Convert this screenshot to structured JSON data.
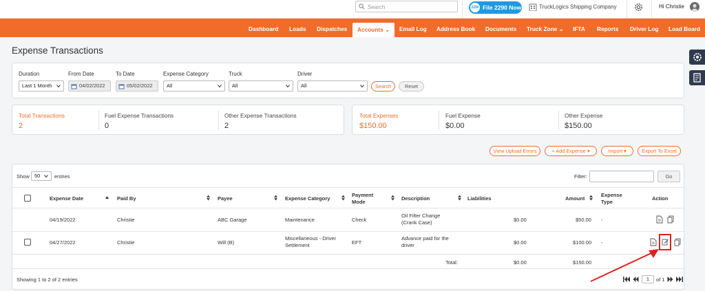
{
  "topbar": {
    "search_placeholder": "Search",
    "file2290_label": "File 2290 Now",
    "file2290_badge": "2290",
    "company_name": "TruckLogics Shipping Company",
    "greeting": "Hi Christie"
  },
  "nav": {
    "items": [
      "Dashboard",
      "Loads",
      "Dispatches",
      "Accounts",
      "Email Log",
      "Address Book",
      "Documents",
      "Truck Zone",
      "IFTA",
      "Reports",
      "Driver Log",
      "Load Board"
    ],
    "active": "Accounts"
  },
  "page": {
    "title": "Expense Transactions"
  },
  "filters": {
    "duration_label": "Duration",
    "duration_value": "Last 1 Month",
    "from_label": "From Date",
    "from_value": "04/02/2022",
    "to_label": "To Date",
    "to_value": "05/02/2022",
    "category_label": "Expense Category",
    "category_value": "All",
    "truck_label": "Truck",
    "truck_value": "All",
    "driver_label": "Driver",
    "driver_value": "All",
    "search_btn": "Search",
    "reset_btn": "Reset"
  },
  "summary": {
    "total_transactions_label": "Total Transactions",
    "total_transactions": "2",
    "fuel_transactions_label": "Fuel Expense Transactions",
    "fuel_transactions": "0",
    "other_transactions_label": "Other Expense Transactions",
    "other_transactions": "2",
    "total_expenses_label": "Total Expenses",
    "total_expenses": "$150.00",
    "fuel_expense_label": "Fuel Expense",
    "fuel_expense": "$0.00",
    "other_expense_label": "Other Expense",
    "other_expense": "$150.00"
  },
  "actions": {
    "view_upload_errors": "View Upload Errors",
    "add_expense": "+ Add Expense",
    "import": "Import",
    "export": "Export To Excel"
  },
  "table": {
    "show_label": "Show",
    "entries_value": "50",
    "entries_label": "entries",
    "filter_label": "Filter:",
    "go_btn": "Go",
    "columns": {
      "date": "Expense Date",
      "paid_by": "Paid By",
      "payee": "Payee",
      "category": "Expense Category",
      "mode_line1": "Payment",
      "mode_line2": "Mode",
      "description": "Description",
      "liabilities": "Liabilities",
      "amount": "Amount",
      "type_line1": "Expense",
      "type_line2": "Type",
      "action": "Action"
    },
    "rows": [
      {
        "date": "04/19/2022",
        "paid_by": "Christie",
        "payee": "ABC Garage",
        "category_l1": "Maintenance",
        "category_l2": "",
        "mode": "Check",
        "desc_l1": "Oil Filter Change",
        "desc_l2": "(Crank Case)",
        "liabilities": "$0.00",
        "amount": "$50.00",
        "type": "-"
      },
      {
        "date": "04/27/2022",
        "paid_by": "Christie",
        "payee": "Will (B)",
        "category_l1": "Miscellaneous - Driver",
        "category_l2": "Settlement",
        "mode": "EFT",
        "desc_l1": "Advance paid for the",
        "desc_l2": "driver",
        "liabilities": "$0.00",
        "amount": "$100.00",
        "type": "-"
      }
    ],
    "total_label": "Total:",
    "total_liabilities": "$0.00",
    "total_amount": "$150.00",
    "showing": "Showing 1 to 2 of 2 entries",
    "page_value": "1",
    "page_of": "of 1"
  },
  "colors": {
    "brand": "#f16b2b",
    "sidebar": "#2f3a4f",
    "annotation": "#e02020"
  }
}
